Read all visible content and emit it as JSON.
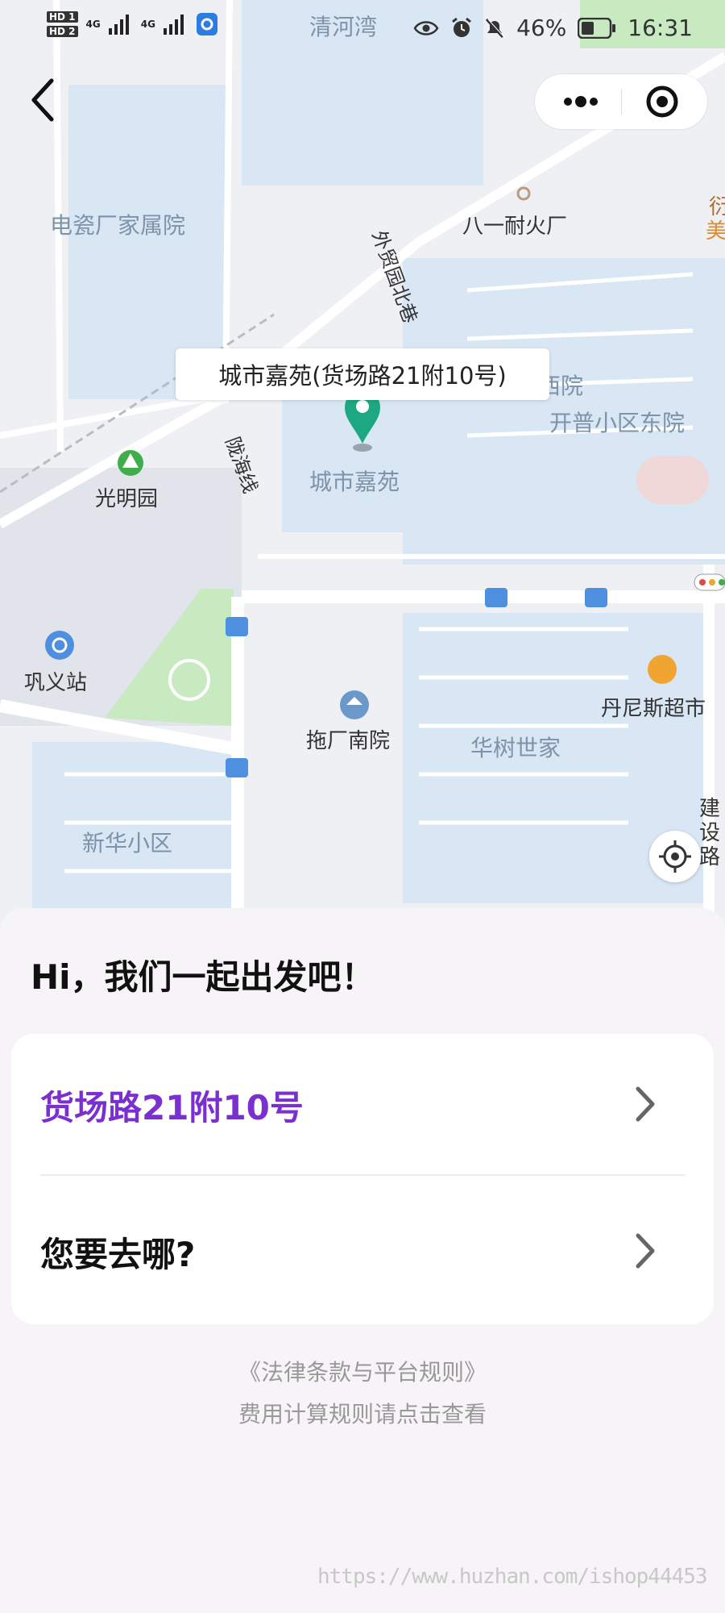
{
  "status_bar": {
    "hd1": "HD 1",
    "hd2": "HD 2",
    "net1": "4G",
    "net2": "4G",
    "battery_percent": "46%",
    "time": "16:31"
  },
  "map": {
    "place_labels": [
      "清河湾",
      "电瓷厂家属院",
      "八一耐火厂",
      "外贸园北巷",
      "开普小区东院",
      "城市嘉苑",
      "陇海线",
      "光明园",
      "巩义站",
      "拖厂南院",
      "华树世家",
      "丹尼斯超市",
      "新华小区",
      "建设路",
      "西院",
      "衍",
      "美"
    ],
    "callout": "城市嘉苑(货场路21附10号)",
    "colors": {
      "marker": "#1ea882",
      "block": "#d9e6f4",
      "green": "#c8eac0",
      "road": "#ffffff"
    }
  },
  "panel": {
    "greeting": "Hi，我们一起出发吧！",
    "origin": "货场路21附10号",
    "destination": "您要去哪?",
    "origin_color": "#7b2fd0",
    "legal_link": "《法律条款与平台规则》",
    "fee_link": "费用计算规则请点击查看"
  },
  "watermark": "https://www.huzhan.com/ishop44453"
}
